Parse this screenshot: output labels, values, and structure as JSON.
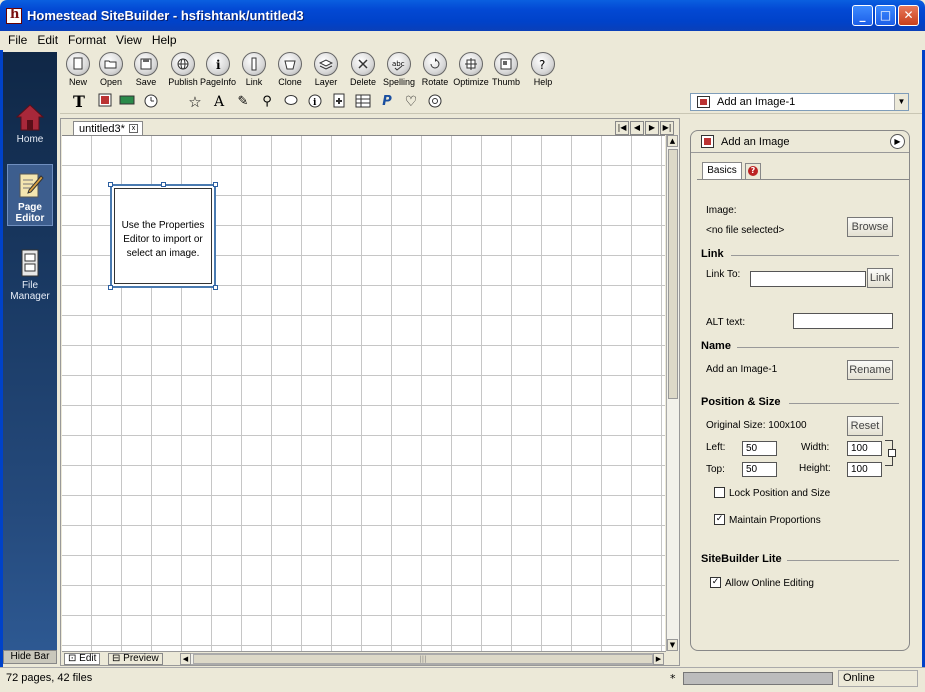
{
  "window": {
    "title": "Homestead SiteBuilder - hsfishtank/untitled3"
  },
  "menu": [
    "File",
    "Edit",
    "Format",
    "View",
    "Help"
  ],
  "sidebar": {
    "items": [
      {
        "label": "Home",
        "icon": "house-icon"
      },
      {
        "label": "Page\nEditor",
        "icon": "page-editor-icon"
      },
      {
        "label": "File\nManager",
        "icon": "file-manager-icon"
      }
    ],
    "hide_bar": "Hide Bar"
  },
  "toolbar": {
    "buttons": [
      {
        "label": "New",
        "icon": "new-page-icon"
      },
      {
        "label": "Open",
        "icon": "open-folder-icon"
      },
      {
        "label": "Save",
        "icon": "save-disk-icon"
      },
      {
        "label": "Publish",
        "icon": "publish-globe-icon"
      },
      {
        "label": "PageInfo",
        "icon": "info-icon"
      },
      {
        "label": "Link",
        "icon": "link-icon"
      },
      {
        "label": "Clone",
        "icon": "clone-icon"
      },
      {
        "label": "Layer",
        "icon": "layer-icon"
      },
      {
        "label": "Delete",
        "icon": "delete-icon"
      },
      {
        "label": "Spelling",
        "icon": "spelling-icon"
      },
      {
        "label": "Rotate",
        "icon": "rotate-icon"
      },
      {
        "label": "Optimize",
        "icon": "optimize-icon"
      },
      {
        "label": "Thumb",
        "icon": "thumbnail-icon"
      },
      {
        "label": "Help",
        "icon": "help-icon"
      }
    ]
  },
  "insert_toolbar": {
    "object_select": "Add an Image-1"
  },
  "editor": {
    "doc_tab": "untitled3*",
    "placeholder_text": "Use the Properties Editor to import or select an image.",
    "bottom_tabs": {
      "edit": "Edit",
      "preview": "Preview"
    }
  },
  "properties": {
    "header": "Add an Image",
    "tab_basics": "Basics",
    "image_label": "Image:",
    "image_value": "<no file selected>",
    "browse": "Browse",
    "link_section": "Link",
    "link_to_label": "Link To:",
    "link_to_value": "",
    "link_button": "Link",
    "alt_label": "ALT text:",
    "alt_value": "",
    "name_section": "Name",
    "name_value": "Add an Image-1",
    "rename": "Rename",
    "position_section": "Position & Size",
    "original_size": "Original Size: 100x100",
    "reset": "Reset",
    "left_label": "Left:",
    "left_value": "50",
    "width_label": "Width:",
    "width_value": "100",
    "top_label": "Top:",
    "top_value": "50",
    "height_label": "Height:",
    "height_value": "100",
    "lock_label": "Lock Position and Size",
    "lock_checked": false,
    "maintain_label": "Maintain Proportions",
    "maintain_checked": true,
    "lite_section": "SiteBuilder Lite",
    "online_edit_label": "Allow Online Editing",
    "online_edit_checked": true
  },
  "status": {
    "pages": "72 pages, 42 files",
    "marker": "*",
    "connection": "Online"
  },
  "colors": {
    "title_bar": "#0042c9",
    "sidebar": "#1a3a64",
    "selection": "#4a7ab0"
  }
}
